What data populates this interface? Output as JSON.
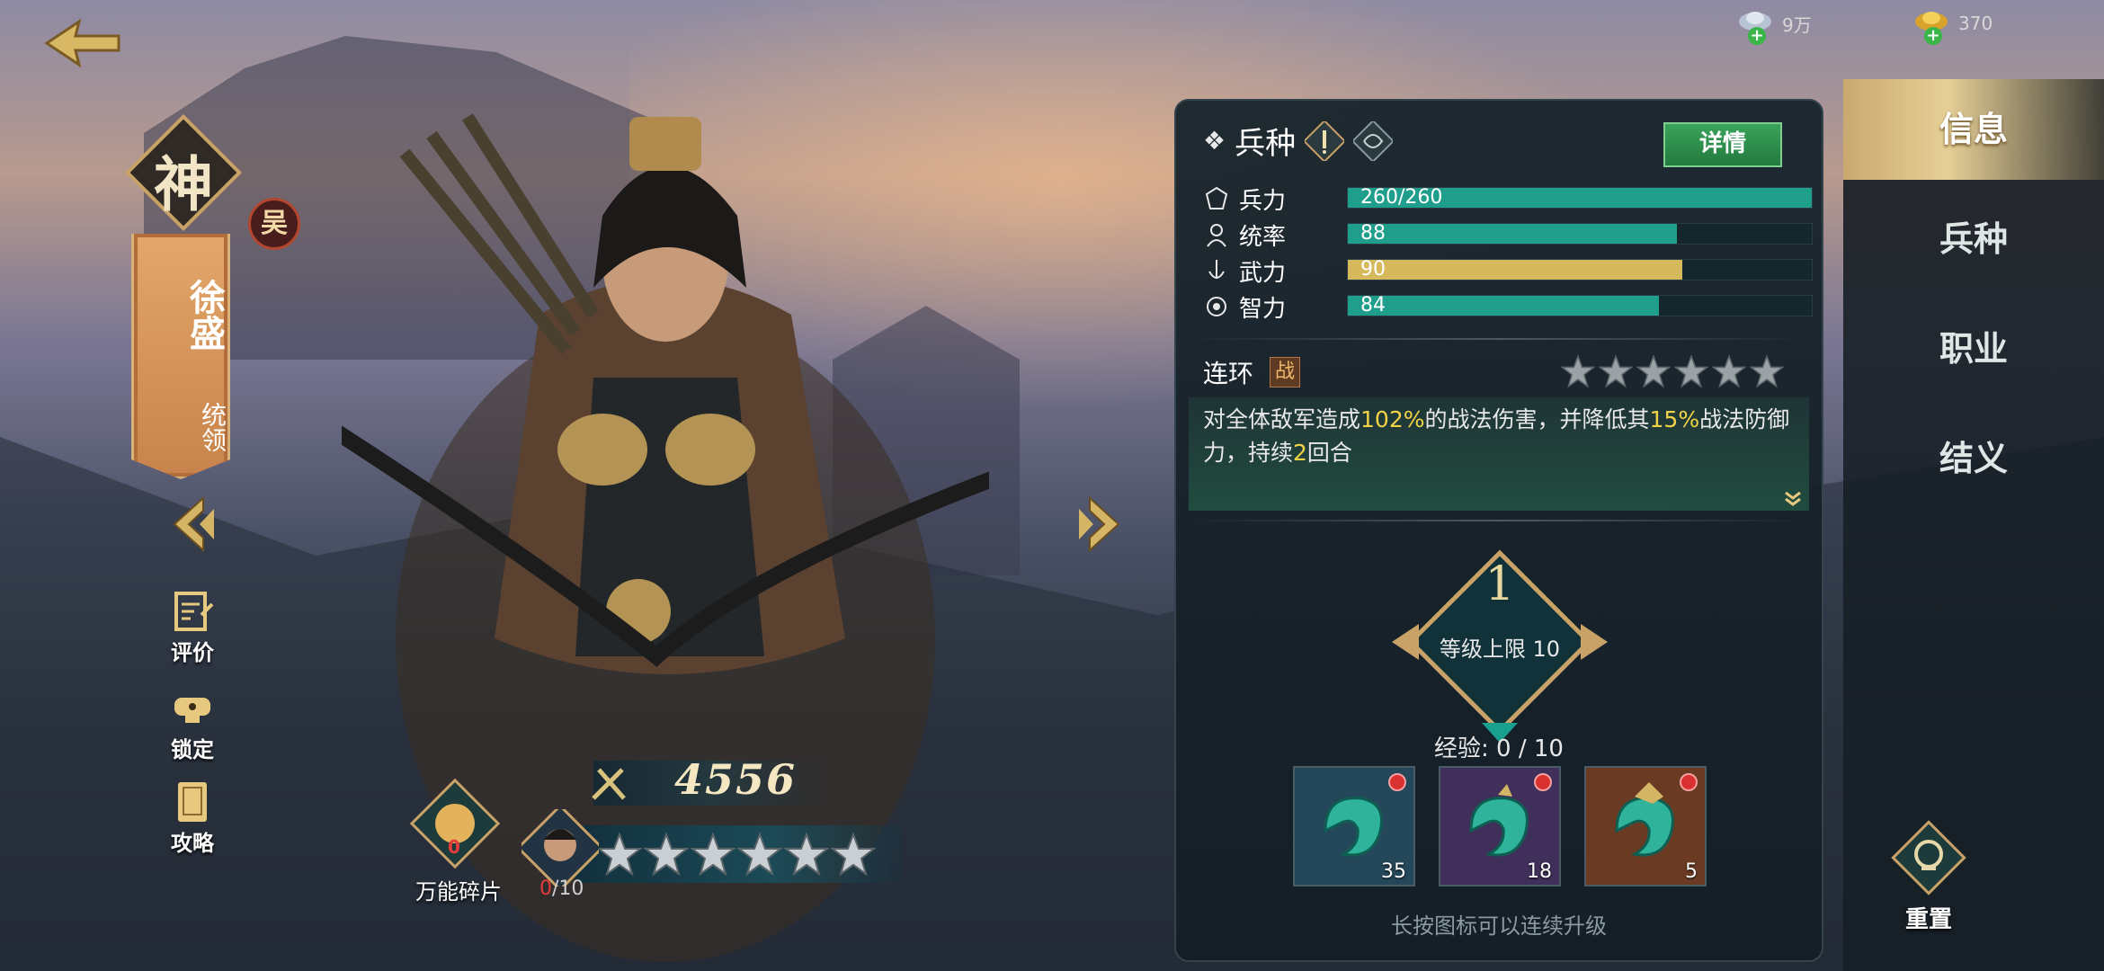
{
  "resources": [
    {
      "icon": "silver-ingot-icon",
      "value": "9万"
    },
    {
      "icon": "gold-ingot-icon",
      "value": "370"
    }
  ],
  "hero": {
    "rank_badge": "神",
    "name": "徐盛",
    "role": "统领",
    "faction": "吴"
  },
  "side_tools": [
    {
      "icon": "review-icon",
      "label": "评价"
    },
    {
      "icon": "lock-icon",
      "label": "锁定"
    },
    {
      "icon": "guide-icon",
      "label": "攻略"
    }
  ],
  "power": "4556",
  "shard": {
    "label": "万能碎片",
    "count": "0"
  },
  "fragments": {
    "current": "0",
    "total": "/10"
  },
  "star_count": 6,
  "panel": {
    "title": "兵种",
    "detail_button": "详情",
    "stats": [
      {
        "icon": "troops-icon",
        "name": "兵力",
        "value": "260/260",
        "ratio": 1.0,
        "color": "#1f9e8c"
      },
      {
        "icon": "command-icon",
        "name": "统率",
        "value": "88",
        "ratio": 0.71,
        "color": "#1f9e8c"
      },
      {
        "icon": "force-icon",
        "name": "武力",
        "value": "90",
        "ratio": 0.72,
        "color": "#d6b95b"
      },
      {
        "icon": "intellect-icon",
        "name": "智力",
        "value": "84",
        "ratio": 0.67,
        "color": "#1f9e8c"
      }
    ],
    "skill": {
      "name": "连环",
      "tag": "战",
      "stars": 6,
      "desc_parts": [
        {
          "text": "对全体敌军造成",
          "hl": false
        },
        {
          "text": "102%",
          "hl": true
        },
        {
          "text": "的战法伤害，并降低其",
          "hl": false
        },
        {
          "text": "15%",
          "hl": true
        },
        {
          "text": "战法防御力，持续",
          "hl": false
        },
        {
          "text": "2",
          "hl": true
        },
        {
          "text": "回合",
          "hl": false
        }
      ]
    },
    "level": "1",
    "level_cap": "等级上限 10",
    "exp": "经验: 0 / 10",
    "items": [
      {
        "icon": "jade-dragon-green-icon",
        "count": "35",
        "bg": "#24475a"
      },
      {
        "icon": "jade-dragon-purple-icon",
        "count": "18",
        "bg": "#3f2f5a"
      },
      {
        "icon": "jade-dragon-orange-icon",
        "count": "5",
        "bg": "#6a3a22"
      }
    ],
    "hint": "长按图标可以连续升级"
  },
  "tabs": [
    {
      "label": "信息",
      "active": true
    },
    {
      "label": "兵种",
      "active": false
    },
    {
      "label": "职业",
      "active": false
    },
    {
      "label": "结义",
      "active": false
    }
  ],
  "reset_label": "重置"
}
